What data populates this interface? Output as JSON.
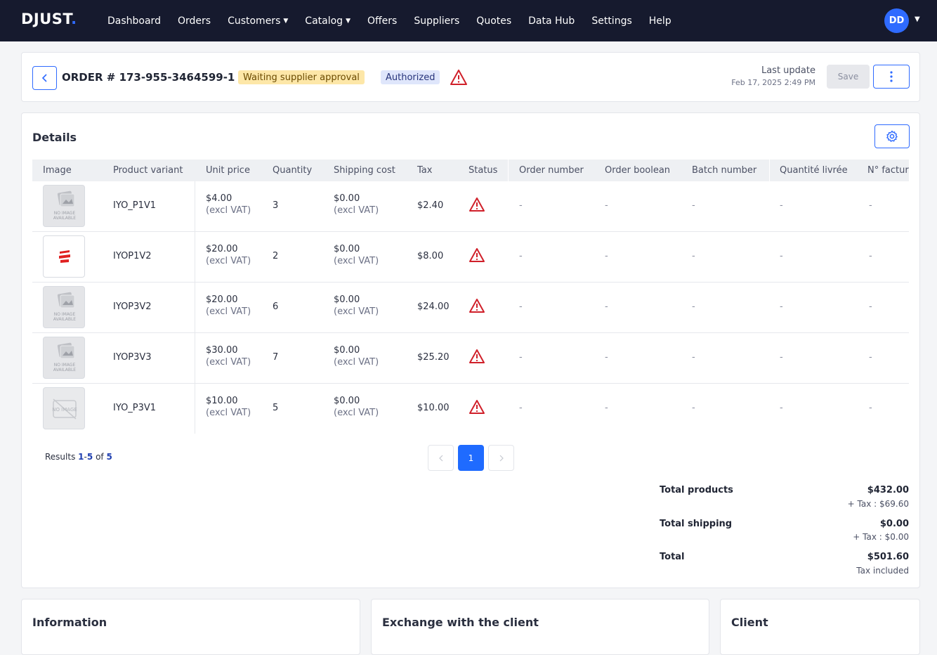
{
  "nav": {
    "logo_main": "DJUST",
    "logo_dot": ".",
    "items": [
      {
        "label": "Dashboard",
        "caret": false
      },
      {
        "label": "Orders",
        "caret": false
      },
      {
        "label": "Customers",
        "caret": true
      },
      {
        "label": "Catalog",
        "caret": true
      },
      {
        "label": "Offers",
        "caret": false
      },
      {
        "label": "Suppliers",
        "caret": false
      },
      {
        "label": "Quotes",
        "caret": false
      },
      {
        "label": "Data Hub",
        "caret": false
      },
      {
        "label": "Settings",
        "caret": false
      },
      {
        "label": "Help",
        "caret": false
      }
    ],
    "avatar_initials": "DD"
  },
  "header": {
    "order_title": "ORDER # 173-955-3464599-1",
    "badge_status": "Waiting supplier approval",
    "badge_payment": "Authorized",
    "last_update_label": "Last update",
    "last_update_date": "Feb 17, 2025 2:49 PM",
    "save_label": "Save"
  },
  "details": {
    "title": "Details",
    "columns": [
      "Image",
      "Product variant",
      "Unit price",
      "Quantity",
      "Shipping cost",
      "Tax",
      "Status",
      "Order number",
      "Order boolean",
      "Batch number",
      "Quantité livrée",
      "N° factur"
    ],
    "rows": [
      {
        "image": "no-image-available",
        "variant": "IYO_P1V1",
        "unit_price": "$4.00",
        "unit_price_note": "(excl VAT)",
        "quantity": "3",
        "shipping": "$0.00",
        "shipping_note": "(excl VAT)",
        "tax": "$2.40",
        "order_number": "-",
        "order_boolean": "-",
        "batch_number": "-",
        "qty_delivered": "-",
        "invoice_no": "-"
      },
      {
        "image": "brand-logo",
        "variant": "IYOP1V2",
        "unit_price": "$20.00",
        "unit_price_note": "(excl VAT)",
        "quantity": "2",
        "shipping": "$0.00",
        "shipping_note": "(excl VAT)",
        "tax": "$8.00",
        "order_number": "-",
        "order_boolean": "-",
        "batch_number": "-",
        "qty_delivered": "-",
        "invoice_no": "-"
      },
      {
        "image": "no-image-available",
        "variant": "IYOP3V2",
        "unit_price": "$20.00",
        "unit_price_note": "(excl VAT)",
        "quantity": "6",
        "shipping": "$0.00",
        "shipping_note": "(excl VAT)",
        "tax": "$24.00",
        "order_number": "-",
        "order_boolean": "-",
        "batch_number": "-",
        "qty_delivered": "-",
        "invoice_no": "-"
      },
      {
        "image": "no-image-available",
        "variant": "IYOP3V3",
        "unit_price": "$30.00",
        "unit_price_note": "(excl VAT)",
        "quantity": "7",
        "shipping": "$0.00",
        "shipping_note": "(excl VAT)",
        "tax": "$25.20",
        "order_number": "-",
        "order_boolean": "-",
        "batch_number": "-",
        "qty_delivered": "-",
        "invoice_no": "-"
      },
      {
        "image": "no-image",
        "variant": "IYO_P3V1",
        "unit_price": "$10.00",
        "unit_price_note": "(excl VAT)",
        "quantity": "5",
        "shipping": "$0.00",
        "shipping_note": "(excl VAT)",
        "tax": "$10.00",
        "order_number": "-",
        "order_boolean": "-",
        "batch_number": "-",
        "qty_delivered": "-",
        "invoice_no": "-"
      }
    ],
    "results": {
      "prefix": "Results",
      "from": "1",
      "sep": "-",
      "to": "5",
      "of": "of",
      "total": "5"
    },
    "pagination": {
      "current": "1"
    },
    "totals": {
      "products_label": "Total products",
      "products_value": "$432.00",
      "products_tax": "+ Tax : $69.60",
      "shipping_label": "Total shipping",
      "shipping_value": "$0.00",
      "shipping_tax": "+ Tax : $0.00",
      "total_label": "Total",
      "total_value": "$501.60",
      "total_note": "Tax included"
    }
  },
  "bottom": {
    "information": "Information",
    "exchange": "Exchange with the client",
    "client": "Client"
  },
  "colors": {
    "accent": "#2f6bff",
    "nav_bg": "#161a2e",
    "warning": "#d0202a"
  }
}
